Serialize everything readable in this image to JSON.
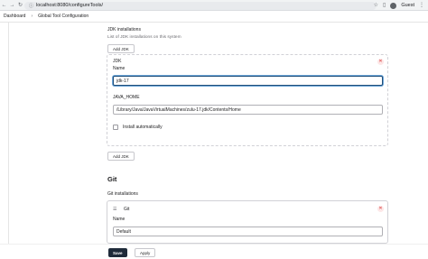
{
  "browser": {
    "url": "localhost:8080/configureTools/",
    "profile_label": "Guest"
  },
  "breadcrumb": [
    "Dashboard",
    "Global Tool Configuration"
  ],
  "jdk": {
    "section_title": "JDK installations",
    "description": "List of JDK installations on this system",
    "add_button": "Add JDK",
    "card_title": "JDK",
    "name_label": "Name",
    "name_value": "jdk-17",
    "home_label": "JAVA_HOME",
    "home_value": "/Library/Java/JavaVirtualMachines/zulu-17.jdk/Contents/Home",
    "install_auto_label": "Install automatically",
    "add_button_bottom": "Add JDK"
  },
  "git": {
    "heading": "Git",
    "section_title": "Git installations",
    "card_title": "Git",
    "name_label": "Name",
    "name_value": "Default"
  },
  "footer": {
    "save": "Save",
    "apply": "Apply"
  }
}
